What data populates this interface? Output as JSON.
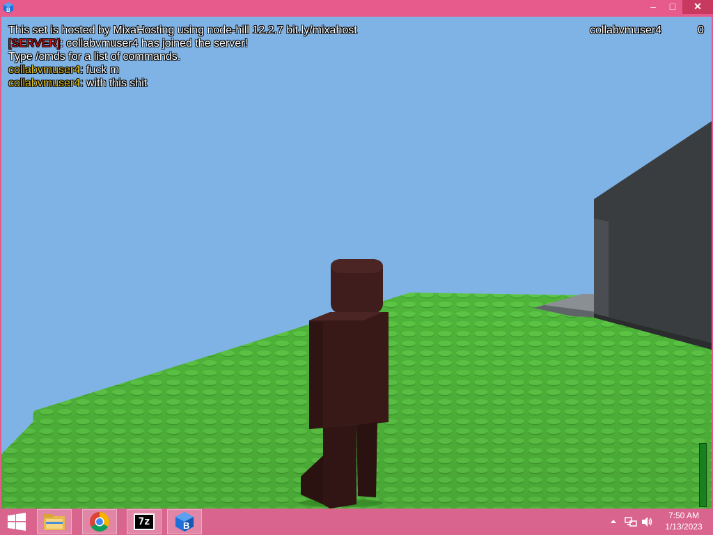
{
  "window": {
    "minimize_glyph": "–",
    "maximize_glyph": "□",
    "close_glyph": "✕",
    "app_icon": "brick-hill-icon"
  },
  "chat": {
    "lines": [
      {
        "prefix": "",
        "text": "This set is hosted by MixaHosting using node-hill 12.2.7 bit.ly/mixahost"
      },
      {
        "prefix": "[SERVER]",
        "text": ": collabvmuser4 has joined the server!"
      },
      {
        "prefix": "",
        "text": "Type /cmds for a list of commands."
      },
      {
        "prefix": "collabvmuser4",
        "text": ": fuck m"
      },
      {
        "prefix": "collabvmuser4",
        "text": ": with this shit"
      }
    ]
  },
  "leaderboard": {
    "player": "collabvmuser4",
    "score": "0"
  },
  "health": {
    "fraction": 1.0
  },
  "colors": {
    "sky": "#7fb3e6",
    "grass": "#4fb53a",
    "avatar": "#3b1a1a",
    "wall": "#373a3d",
    "titlebar": "#e65a8c",
    "taskbar": "#d9658e",
    "server_tag": "#d41414",
    "user_tag": "#e4c21d"
  },
  "taskbar": {
    "apps": [
      {
        "name": "file-explorer-icon"
      },
      {
        "name": "chrome-icon"
      },
      {
        "name": "7zip-icon",
        "label": "7z"
      },
      {
        "name": "brick-hill-icon",
        "label": "B"
      }
    ],
    "time": "7:50 AM",
    "date": "1/13/2023"
  }
}
